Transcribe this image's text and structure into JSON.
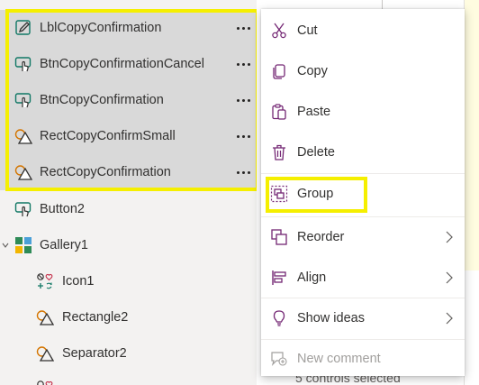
{
  "tree": {
    "items": [
      {
        "label": "LblCopyConfirmation",
        "icon": "label-edit-icon",
        "selected": true
      },
      {
        "label": "BtnCopyConfirmationCancel",
        "icon": "button-touch-icon",
        "selected": true
      },
      {
        "label": "BtnCopyConfirmation",
        "icon": "button-touch-icon",
        "selected": true
      },
      {
        "label": "RectCopyConfirmSmall",
        "icon": "shapes-icon",
        "selected": true
      },
      {
        "label": "RectCopyConfirmation",
        "icon": "shapes-icon",
        "selected": true
      },
      {
        "label": "Button2",
        "icon": "button-touch-icon",
        "selected": false
      },
      {
        "label": "Gallery1",
        "icon": "gallery-icon",
        "selected": false,
        "expanded": true
      },
      {
        "label": "Icon1",
        "icon": "icon-control-icon",
        "selected": false
      },
      {
        "label": "Rectangle2",
        "icon": "shapes-icon",
        "selected": false
      },
      {
        "label": "Separator2",
        "icon": "shapes-icon",
        "selected": false
      }
    ],
    "more_glyph": "···"
  },
  "context_menu": {
    "items": [
      {
        "label": "Cut",
        "icon": "scissors-icon"
      },
      {
        "label": "Copy",
        "icon": "copy-icon"
      },
      {
        "label": "Paste",
        "icon": "paste-icon"
      },
      {
        "label": "Delete",
        "icon": "trash-icon"
      },
      {
        "label": "Group",
        "icon": "group-icon"
      },
      {
        "label": "Reorder",
        "icon": "reorder-icon",
        "submenu": true
      },
      {
        "label": "Align",
        "icon": "align-icon",
        "submenu": true
      },
      {
        "label": "Show ideas",
        "icon": "lightbulb-icon",
        "submenu": true
      },
      {
        "label": "New comment",
        "icon": "comment-add-icon",
        "disabled": true
      }
    ]
  },
  "status": {
    "text": "5 controls selected"
  },
  "colors": {
    "highlight": "#f5ef00",
    "icon_purple": "#742774",
    "selected_row": "#d9d9d9"
  }
}
